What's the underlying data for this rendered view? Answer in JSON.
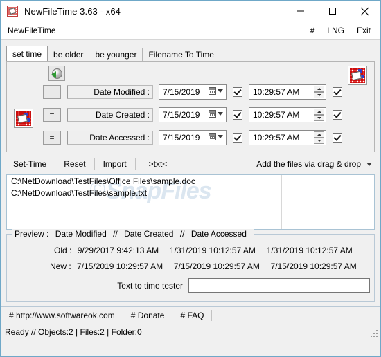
{
  "titlebar": {
    "title": "NewFileTime 3.63 - x64",
    "icon": "app-calendar-icon",
    "minimize": "minimize-icon",
    "maximize": "maximize-icon",
    "close": "close-icon"
  },
  "menubar": {
    "app_name": "NewFileTime",
    "right_items": [
      {
        "label": "#",
        "name": "hash"
      },
      {
        "label": "LNG",
        "name": "language"
      },
      {
        "label": "Exit",
        "name": "exit"
      }
    ]
  },
  "tabs": [
    {
      "label": "set time",
      "active": true
    },
    {
      "label": "be older",
      "active": false
    },
    {
      "label": "be younger",
      "active": false
    },
    {
      "label": "Filename To Time",
      "active": false
    }
  ],
  "tabpage": {
    "globe_button": "globe-refresh-icon",
    "rows": [
      {
        "eq": "=",
        "label": "Date Modified :",
        "date": "7/15/2019",
        "time": "10:29:57 AM",
        "date_checked": true,
        "time_checked": true
      },
      {
        "eq": "=",
        "label": "Date Created :",
        "date": "7/15/2019",
        "time": "10:29:57 AM",
        "date_checked": true,
        "time_checked": true
      },
      {
        "eq": "=",
        "label": "Date Accessed :",
        "date": "7/15/2019",
        "time": "10:29:57 AM",
        "date_checked": true,
        "time_checked": true
      }
    ]
  },
  "actionbar": {
    "buttons": [
      {
        "label": "Set-Time"
      },
      {
        "label": "Reset"
      },
      {
        "label": "Import"
      },
      {
        "label": "=>txt<="
      }
    ],
    "dropdown_label": "Add the files via drag & drop"
  },
  "filelist": {
    "watermark": "SnapFiles",
    "items": [
      "C:\\NetDownload\\TestFiles\\Office Files\\sample.doc",
      "C:\\NetDownload\\TestFiles\\sample.txt"
    ]
  },
  "preview": {
    "legend_prefix": "Preview :",
    "legend_parts": [
      "Date Modified",
      "Date Created",
      "Date Accessed"
    ],
    "legend_sep": "//",
    "old_label": "Old :",
    "old_modified": "9/29/2017 9:42:13 AM",
    "old_created": "1/31/2019 10:12:57 AM",
    "old_accessed": "1/31/2019 10:12:57 AM",
    "new_label": "New :",
    "new_modified": "7/15/2019 10:29:57 AM",
    "new_created": "7/15/2019 10:29:57 AM",
    "new_accessed": "7/15/2019 10:29:57 AM",
    "tester_label": "Text to time tester",
    "tester_value": "",
    "tester_placeholder": ""
  },
  "linkbar": {
    "links": [
      {
        "label": "# http://www.softwareok.com"
      },
      {
        "label": "# Donate"
      },
      {
        "label": "# FAQ"
      }
    ]
  },
  "statusbar": {
    "text": "Ready // Objects:2 | Files:2  | Folder:0"
  },
  "colors": {
    "window_border": "#6fa8c8",
    "background": "#f0f0f0",
    "accent_red": "#e33b3b",
    "accent_blue": "#2a3fcf",
    "accent_green": "#2e9b33",
    "watermark": "#dbe6f0"
  }
}
